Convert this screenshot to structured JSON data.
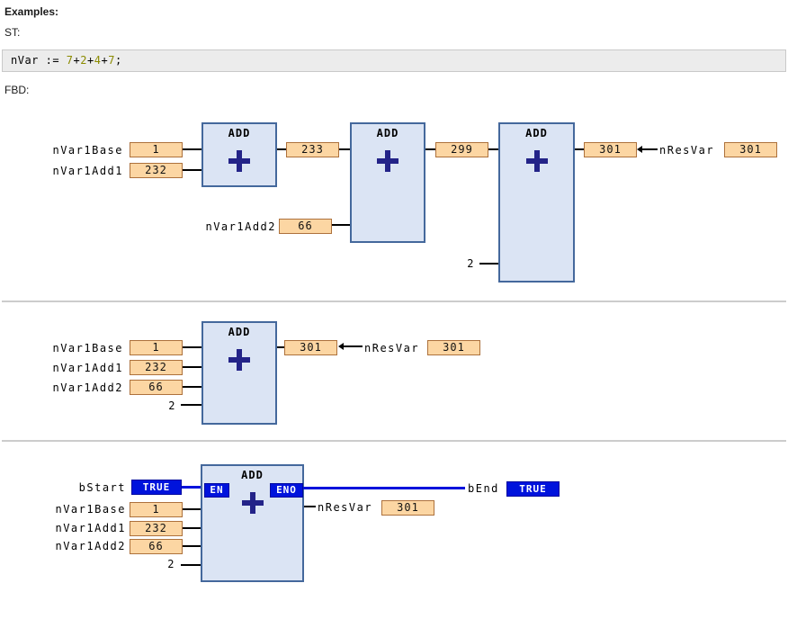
{
  "header": {
    "examples_label": "Examples:",
    "st_label": "ST:",
    "fbd_label": "FBD:"
  },
  "code": {
    "tokens": [
      {
        "text": "nVar := "
      },
      {
        "text": "7"
      },
      {
        "text": "+"
      },
      {
        "text": "2"
      },
      {
        "text": "+"
      },
      {
        "text": "4"
      },
      {
        "text": "+"
      },
      {
        "text": "7"
      },
      {
        "text": ";"
      }
    ]
  },
  "colors": {
    "block_fill": "#dbe4f4",
    "block_border": "#44689c",
    "plus_sign": "#232388",
    "value_box_fill": "#fcd6a3",
    "value_box_border": "#ad713c",
    "boolean_blue": "#0013dc",
    "code_background": "#ececec",
    "number_token": "#8b8b00",
    "separator": "#cccccc"
  },
  "fbd1": {
    "block_title": "ADD",
    "in_base": {
      "label": "nVar1Base",
      "value": "1"
    },
    "in_add1": {
      "label": "nVar1Add1",
      "value": "232"
    },
    "in_add2": {
      "label": "nVar1Add2",
      "value": "66"
    },
    "in_const": "2",
    "out1": "233",
    "out2": "299",
    "out3": "301",
    "result": {
      "label": "nResVar",
      "value": "301"
    }
  },
  "fbd2": {
    "block_title": "ADD",
    "in_base": {
      "label": "nVar1Base",
      "value": "1"
    },
    "in_add1": {
      "label": "nVar1Add1",
      "value": "232"
    },
    "in_add2": {
      "label": "nVar1Add2",
      "value": "66"
    },
    "in_const": "2",
    "out": "301",
    "result": {
      "label": "nResVar",
      "value": "301"
    }
  },
  "fbd3": {
    "block_title": "ADD",
    "en_label": "EN",
    "eno_label": "ENO",
    "bstart": {
      "label": "bStart",
      "value": "TRUE"
    },
    "bend": {
      "label": "bEnd",
      "value": "TRUE"
    },
    "in_base": {
      "label": "nVar1Base",
      "value": "1"
    },
    "in_add1": {
      "label": "nVar1Add1",
      "value": "232"
    },
    "in_add2": {
      "label": "nVar1Add2",
      "value": "66"
    },
    "in_const": "2",
    "result": {
      "label": "nResVar",
      "value": "301"
    }
  }
}
